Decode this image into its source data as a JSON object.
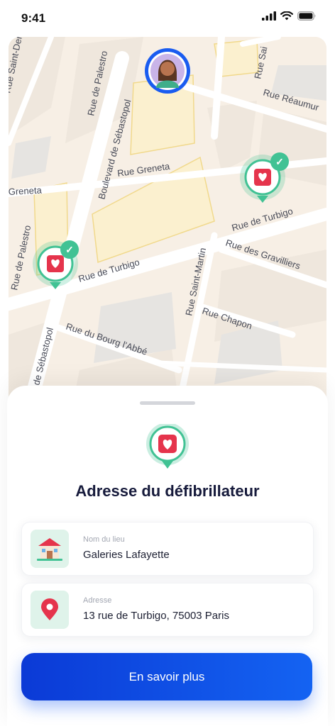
{
  "status": {
    "time": "9:41"
  },
  "map": {
    "streets": [
      "Rue de Palestro",
      "Boulevard de Sébastopol",
      "Rue Saint-Denis",
      "Rue Réaumur",
      "Rue Greneta",
      "Greneta",
      "Rue de Turbigo",
      "Rue de Turbigo",
      "Rue des Gravilliers",
      "Rue Saint-Martin",
      "Rue Chapon",
      "Rue du Bourg l'Abbé",
      "Rue de Palestro",
      "vard de Sébastopol",
      "Rue Sai"
    ],
    "marker_ok_glyph": "✓"
  },
  "sheet": {
    "title": "Adresse du défibrillateur",
    "place_label": "Nom du lieu",
    "place_value": "Galeries Lafayette",
    "address_label": "Adresse",
    "address_value": "13 rue de Turbigo, 75003 Paris",
    "cta": "En savoir plus"
  },
  "colors": {
    "accent": "#1463f2",
    "marker_ring": "#41c294",
    "aed_red": "#e5344c",
    "title": "#161a3b"
  }
}
